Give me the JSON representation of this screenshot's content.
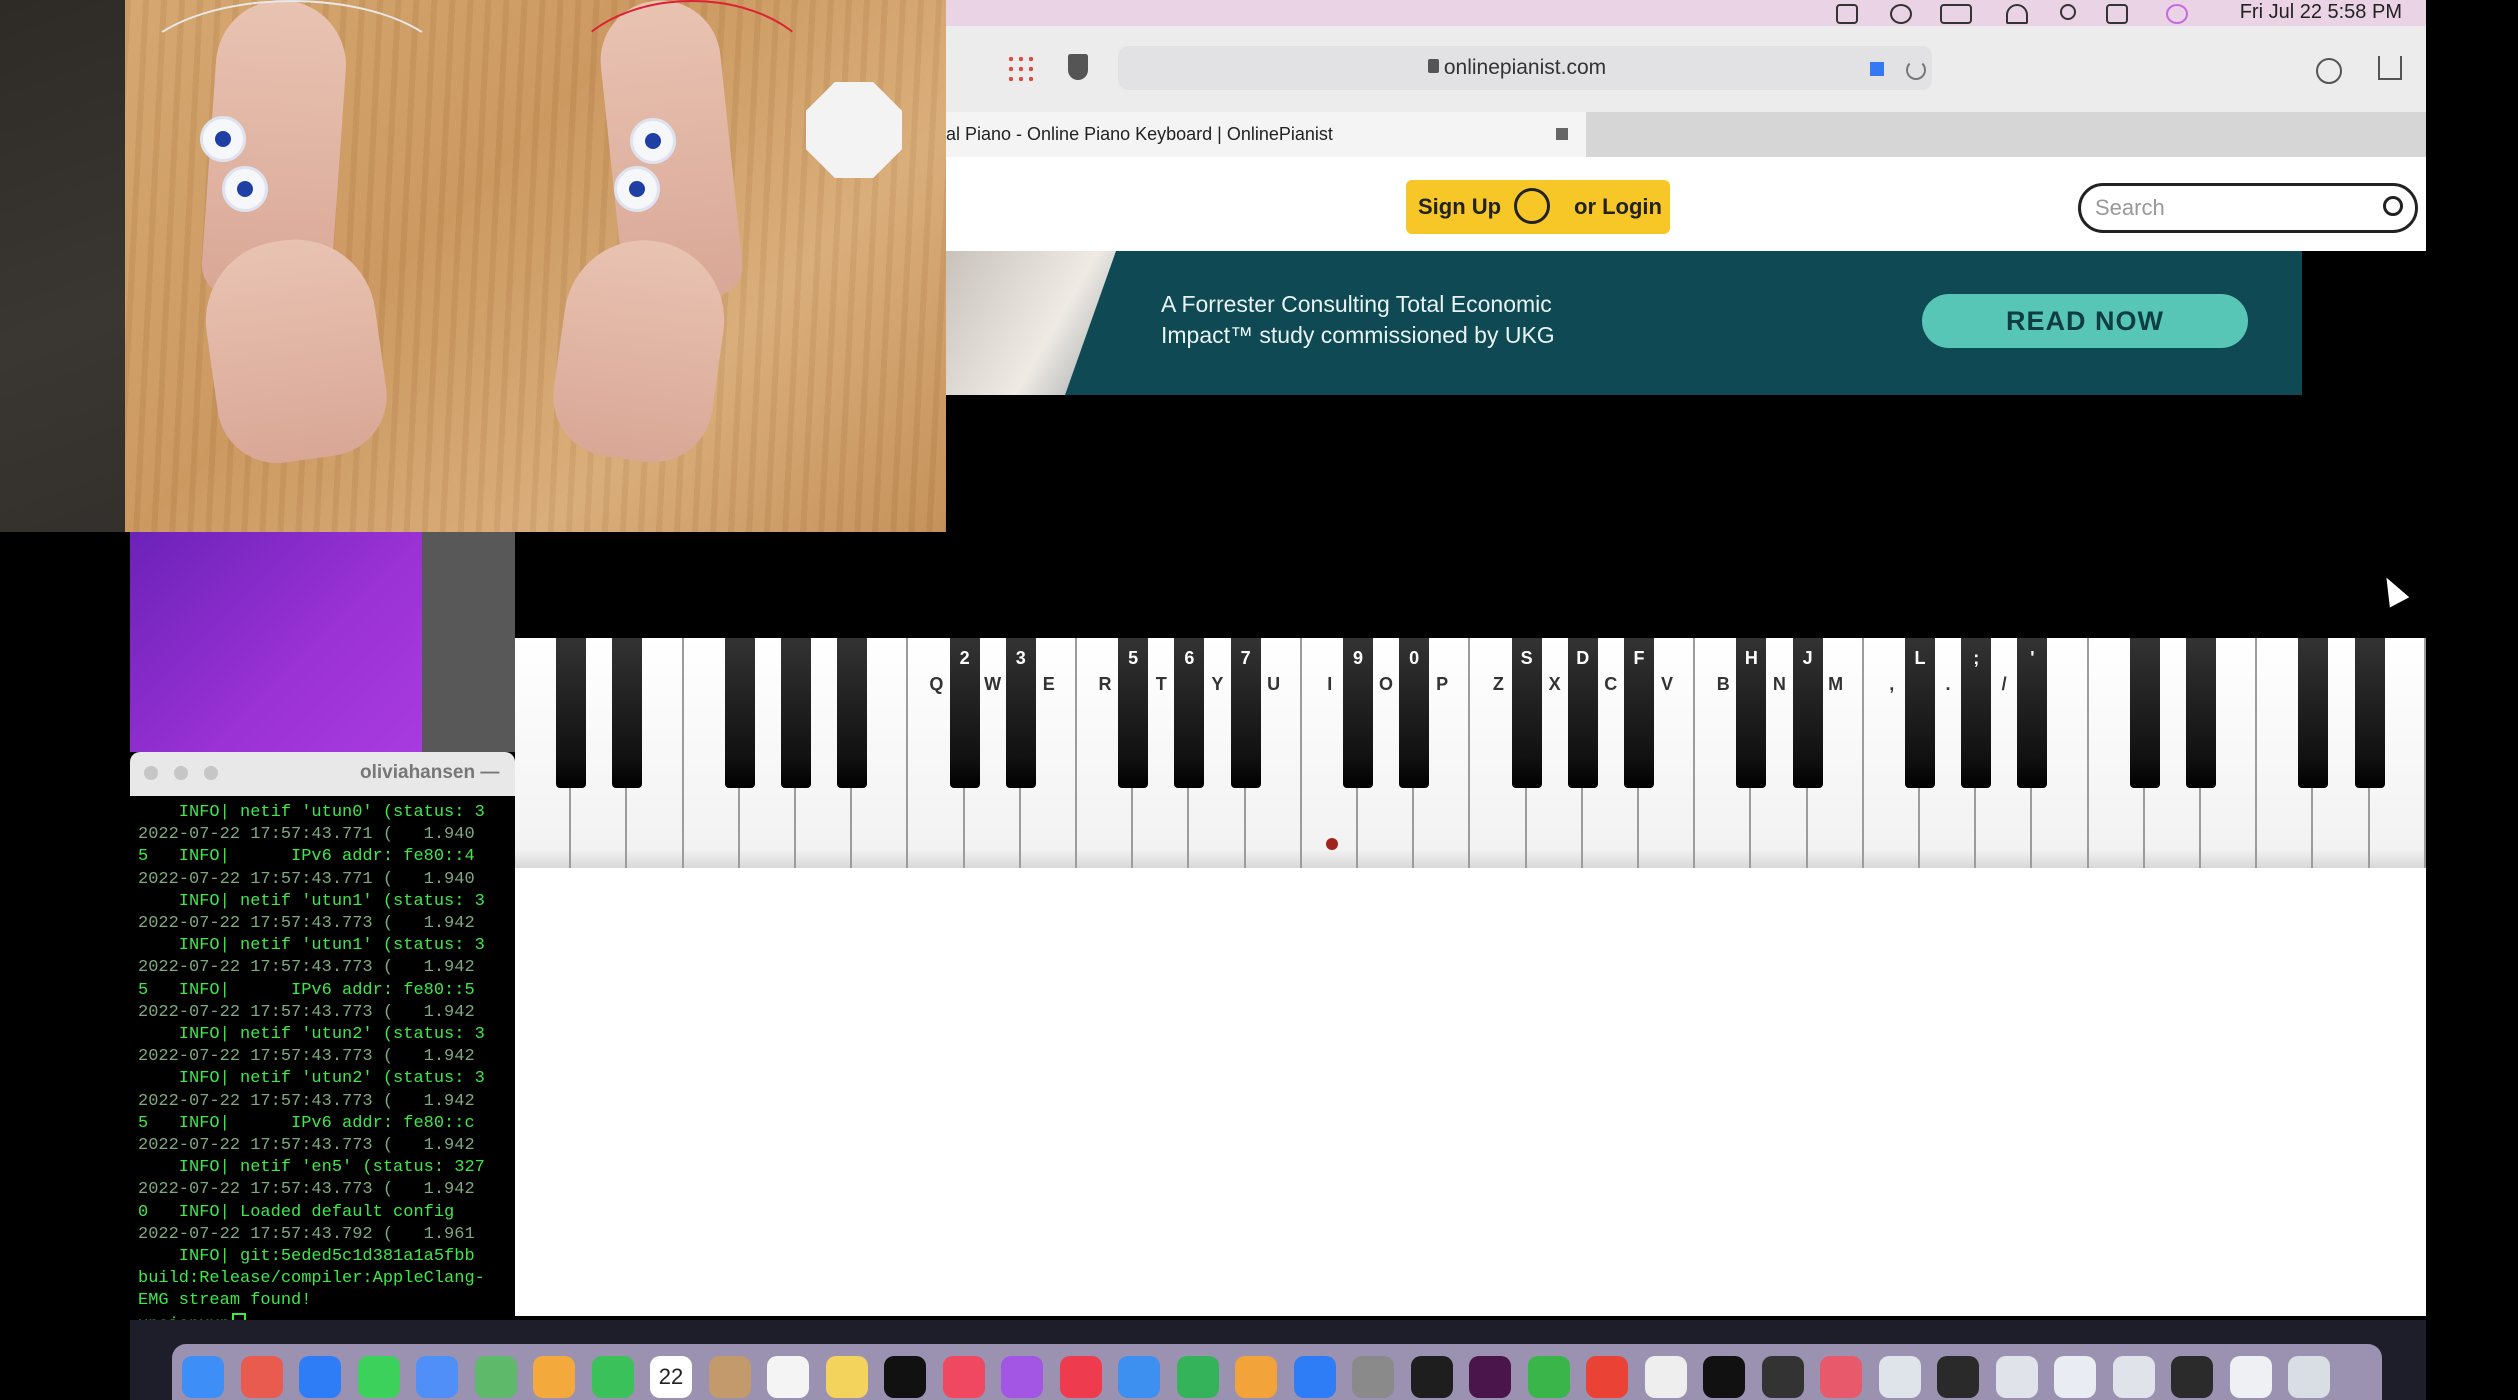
{
  "menubar": {
    "clock": "Fri Jul 22  5:58 PM"
  },
  "browser": {
    "url": "onlinepianist.com",
    "tab_title": "al Piano - Online Piano Keyboard | OnlinePianist"
  },
  "site_header": {
    "sign_up": "Sign Up",
    "or_login": "or Login",
    "search_placeholder": "Search"
  },
  "ad": {
    "text": "A Forrester Consulting Total Economic Impact™ study commissioned by UKG",
    "cta": "READ NOW"
  },
  "piano": {
    "white_labels": [
      "Q",
      "W",
      "E",
      "R",
      "T",
      "Y",
      "U",
      "I",
      "O",
      "P",
      "Z",
      "X",
      "C",
      "V",
      "B",
      "N",
      "M",
      ",",
      ".",
      "/"
    ],
    "black_labels": [
      "2",
      "3",
      "5",
      "6",
      "7",
      "9",
      "0",
      "S",
      "D",
      "F",
      "H",
      "J",
      "L",
      ";",
      "'"
    ]
  },
  "terminal": {
    "title": "oliviahansen —",
    "lines": [
      "    INFO| netif 'utun0' (status: 3",
      "2022-07-22 17:57:43.771 (   1.940",
      "5   INFO|      IPv6 addr: fe80::4",
      "2022-07-22 17:57:43.771 (   1.940",
      "    INFO| netif 'utun1' (status: 3",
      "2022-07-22 17:57:43.773 (   1.942",
      "    INFO| netif 'utun1' (status: 3",
      "2022-07-22 17:57:43.773 (   1.942",
      "5   INFO|      IPv6 addr: fe80::5",
      "2022-07-22 17:57:43.773 (   1.942",
      "    INFO| netif 'utun2' (status: 3",
      "2022-07-22 17:57:43.773 (   1.942",
      "    INFO| netif 'utun2' (status: 3",
      "2022-07-22 17:57:43.773 (   1.942",
      "5   INFO|      IPv6 addr: fe80::c",
      "2022-07-22 17:57:43.773 (   1.942",
      "    INFO| netif 'en5' (status: 327",
      "2022-07-22 17:57:43.773 (   1.942",
      "0   INFO| Loaded default config",
      "2022-07-22 17:57:43.792 (   1.961",
      "    INFO| git:5eded5c1d381a1a5fbb",
      "build:Release/compiler:AppleClang-",
      "EMG stream found!",
      "xpoiopxxp"
    ]
  },
  "dock": {
    "calendar_day": "22",
    "icons": [
      "finder-icon",
      "launchpad-icon",
      "safari-icon",
      "messages-icon",
      "mail-icon",
      "maps-icon",
      "photos-icon",
      "facetime-icon",
      "calendar-icon",
      "contacts-icon",
      "reminders-icon",
      "notes-icon",
      "appletv-icon",
      "music-icon",
      "podcasts-icon",
      "news-icon",
      "keynote-icon",
      "numbers-icon",
      "pages-icon",
      "appstore-icon",
      "settings-icon",
      "terminal-icon",
      "slack-icon",
      "spinner-icon",
      "chrome-icon",
      "app-icon",
      "media-icon",
      "obs-icon",
      "app2-icon",
      "window-thumb-icon",
      "window-thumb-icon",
      "window-thumb-icon",
      "window-thumb-icon",
      "window-thumb-icon",
      "window-thumb-icon",
      "window-thumb-icon",
      "trash-icon"
    ]
  }
}
